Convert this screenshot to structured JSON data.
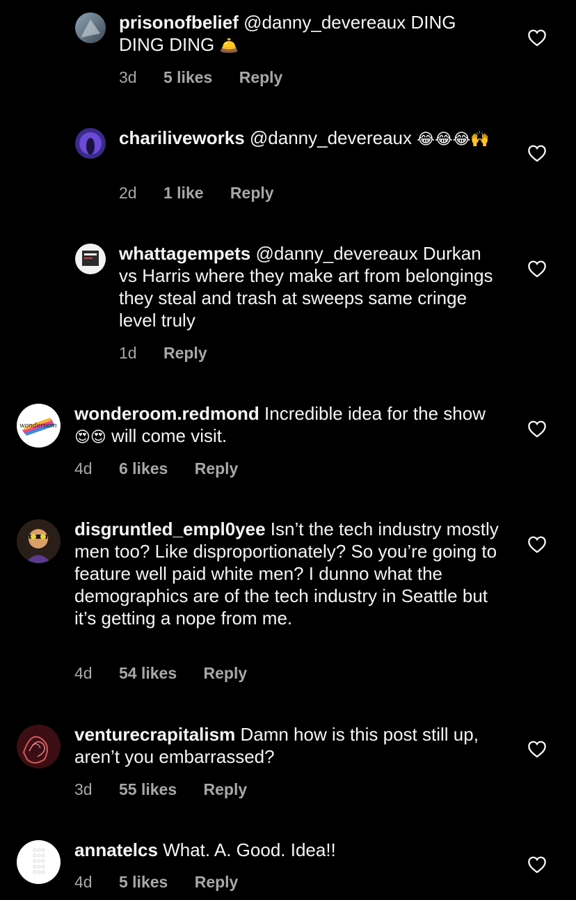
{
  "comments": [
    {
      "username": "prisonofbelief",
      "text": "@danny_devereaux DING DING DING",
      "emoji": "🛎️",
      "time": "3d",
      "likes": "5 likes",
      "reply": "Reply"
    },
    {
      "username": "chariliveworks",
      "text": "@danny_devereaux",
      "emoji": "😂😂😂🙌",
      "time": "2d",
      "likes": "1 like",
      "reply": "Reply"
    },
    {
      "username": "whattagempets",
      "text": "@danny_devereaux Durkan vs Harris where they make art from belongings they steal and trash at sweeps same cringe level truly",
      "time": "1d",
      "reply": "Reply"
    },
    {
      "username": "wonderoom.redmond",
      "text_before": "Incredible idea for the show",
      "emoji": "😍😍",
      "text_after": "will come visit.",
      "time": "4d",
      "likes": "6 likes",
      "reply": "Reply"
    },
    {
      "username": "disgruntled_empl0yee",
      "text": "Isn’t the tech industry mostly men too? Like disproportionately? So you’re going to feature well paid white men? I dunno what the demographics are of the tech industry in Seattle but it’s getting a nope from me.",
      "time": "4d",
      "likes": "54 likes",
      "reply": "Reply"
    },
    {
      "username": "venturecrapitalism",
      "text": "Damn how is this post still up, aren’t you embarrassed?",
      "time": "3d",
      "likes": "55 likes",
      "reply": "Reply"
    },
    {
      "username": "annatelcs",
      "text": "What. A. Good. Idea!!",
      "time": "4d",
      "likes": "5 likes",
      "reply": "Reply"
    }
  ],
  "icons": {
    "like": "heart-outline-icon"
  },
  "colors": {
    "background": "#000000",
    "text": "#f5f5f5",
    "secondary": "#a8a8a8"
  }
}
